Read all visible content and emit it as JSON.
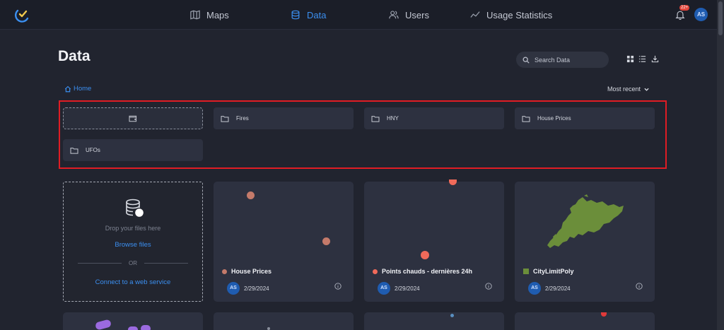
{
  "nav": {
    "items": [
      {
        "label": "Maps",
        "icon": "map-icon"
      },
      {
        "label": "Data",
        "icon": "database-icon",
        "active": true
      },
      {
        "label": "Users",
        "icon": "users-icon"
      },
      {
        "label": "Usage Statistics",
        "icon": "line-chart-icon"
      }
    ],
    "notification_count": "22+",
    "user_initials": "AS"
  },
  "page": {
    "title": "Data",
    "search_placeholder": "Search Data",
    "breadcrumb_home": "Home",
    "sort_label": "Most recent"
  },
  "folders": [
    {
      "label": "Fires"
    },
    {
      "label": "HNY"
    },
    {
      "label": "House Prices"
    },
    {
      "label": "UFOs"
    }
  ],
  "upload": {
    "drop_text": "Drop your files here",
    "browse_label": "Browse files",
    "or_text": "OR",
    "connect_label": "Connect to a web service"
  },
  "datasets": [
    {
      "title": "House Prices",
      "date": "2/29/2024",
      "owner": "AS",
      "color": "#c47a6a"
    },
    {
      "title": "Points chauds - dernières 24h",
      "date": "2/29/2024",
      "owner": "AS",
      "color": "#f06a5a"
    },
    {
      "title": "CityLimitPoly",
      "date": "2/29/2024",
      "owner": "AS",
      "color": "#6b8e3a"
    }
  ],
  "colors": {
    "accent": "#3b8ff0",
    "highlight_box": "#e01c24",
    "background": "#21242f",
    "card": "#2d3140"
  }
}
